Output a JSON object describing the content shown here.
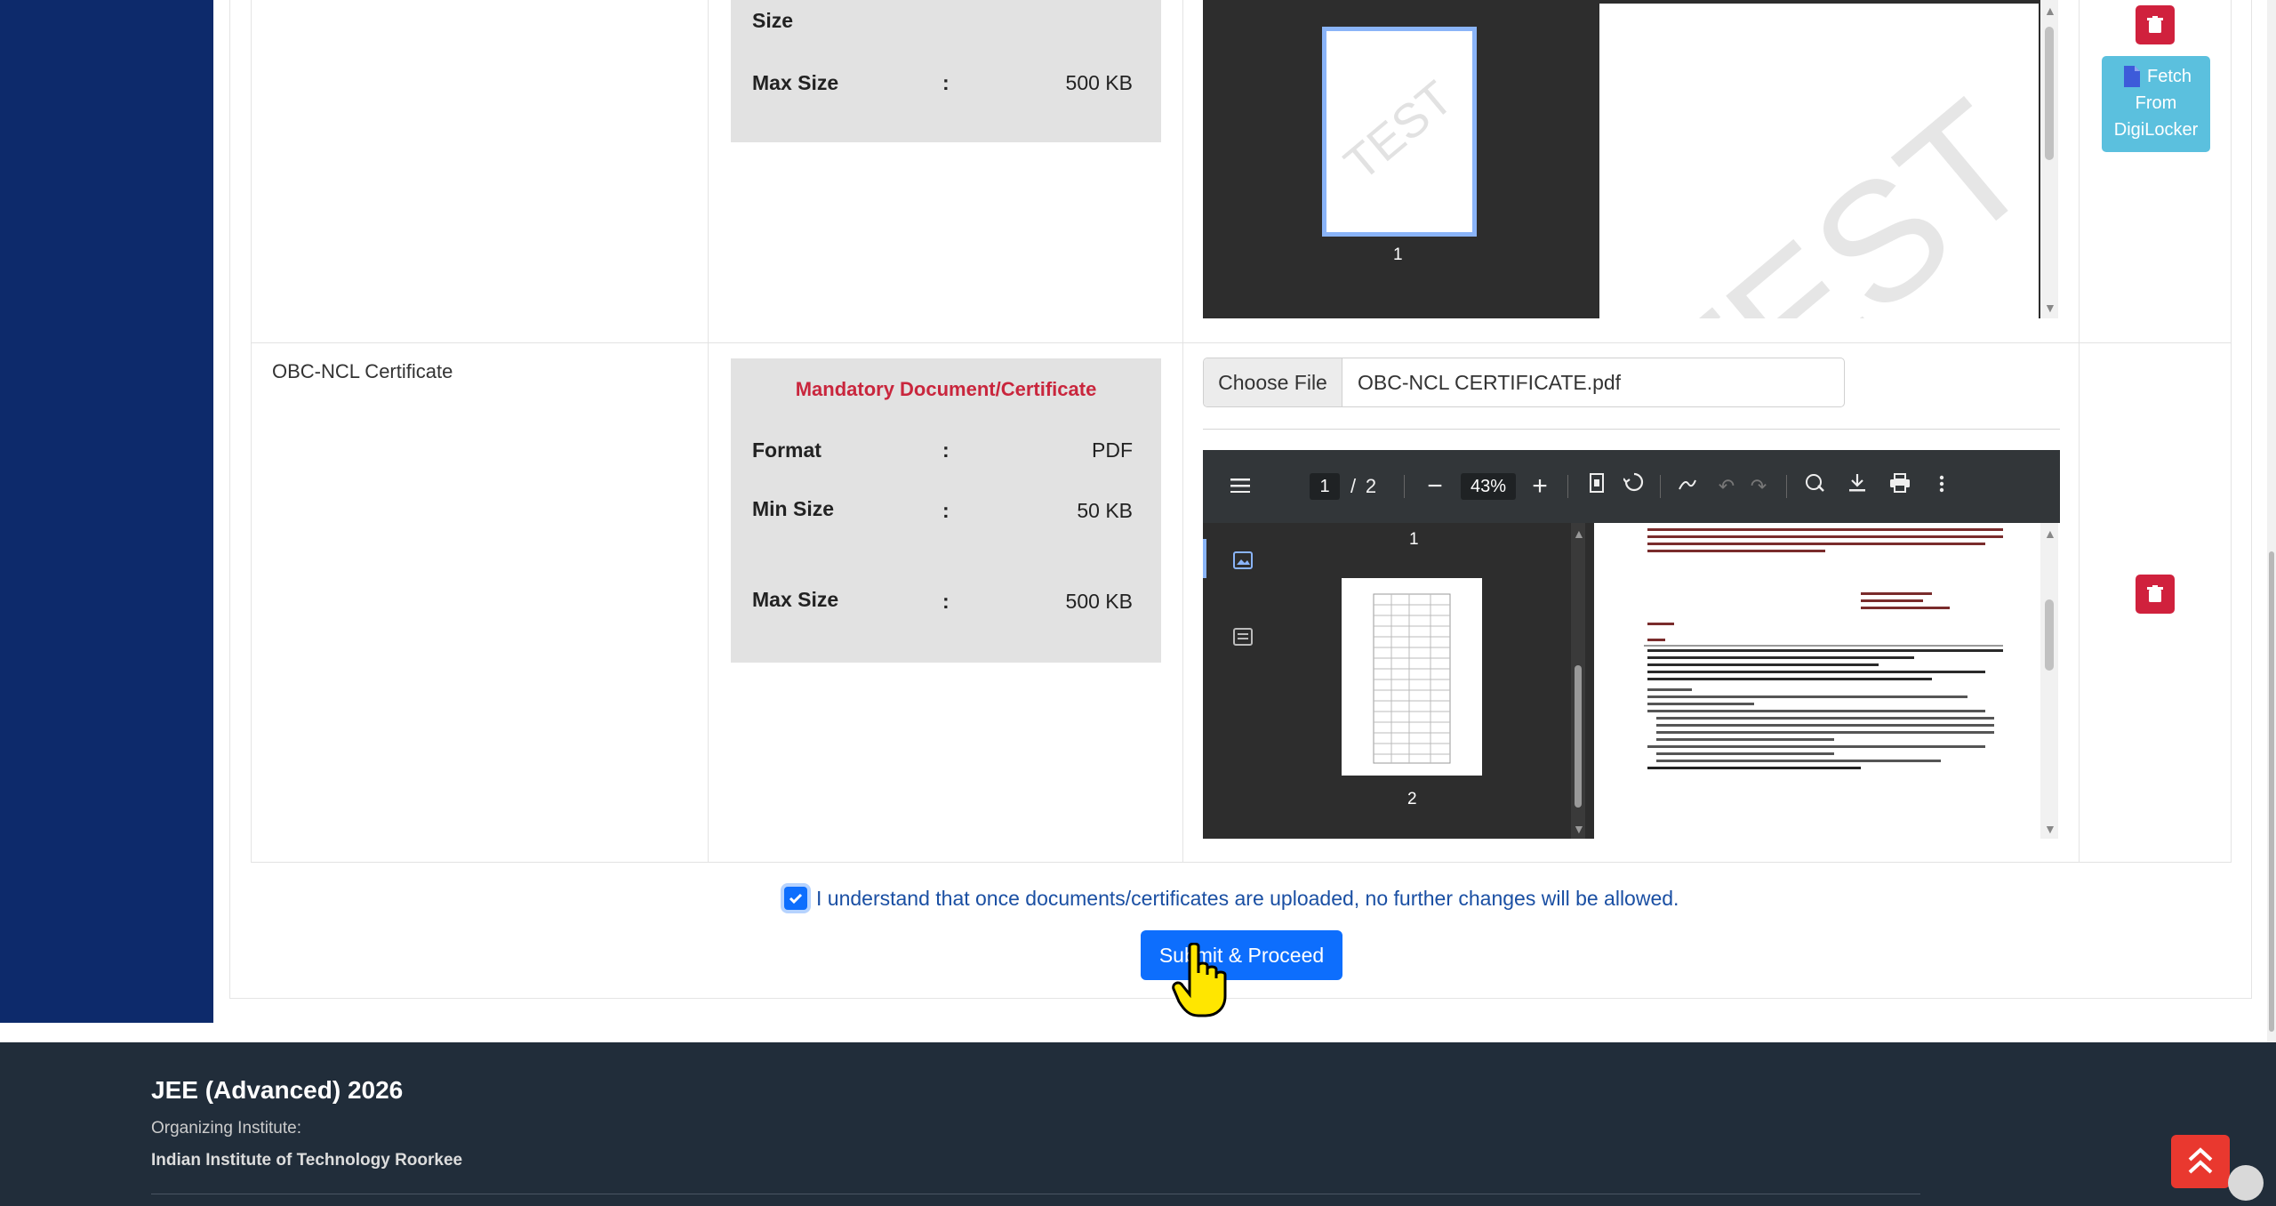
{
  "documents": [
    {
      "name": "",
      "requirements": {
        "title": "",
        "max_label": "Max Size",
        "max_value": "500 KB",
        "partial_label": "Size"
      },
      "preview": {
        "thumb_page": "1",
        "watermark": "TEST"
      },
      "digilocker_button": "Fetch From DigiLocker"
    },
    {
      "name": "OBC-NCL Certificate",
      "requirements": {
        "title": "Mandatory Document/Certificate",
        "format_label": "Format",
        "format_value": "PDF",
        "min_label": "Min Size",
        "min_value": "50 KB",
        "max_label": "Max Size",
        "max_value": "500 KB",
        "colon": ":"
      },
      "file_input": {
        "button_label": "Choose File",
        "file_name": "OBC-NCL CERTIFICATE.pdf"
      },
      "viewer": {
        "current_page": "1",
        "page_separator": "/",
        "total_pages": "2",
        "zoom": "43%",
        "thumb_page_1": "1",
        "thumb_page_2": "2"
      }
    }
  ],
  "agreement": {
    "checked": true,
    "text": "I understand that once documents/certificates are uploaded, no further changes will be allowed."
  },
  "submit_label": "Submit & Proceed",
  "footer": {
    "title": "JEE (Advanced) 2026",
    "organizing_label": "Organizing Institute:",
    "institute": "Indian Institute of Technology Roorkee"
  },
  "icons": {
    "menu": "menu-icon",
    "zoom_out": "zoom-out-icon",
    "zoom_in": "zoom-in-icon",
    "fit_page": "fit-page-icon",
    "rotate": "rotate-icon",
    "draw": "draw-icon",
    "undo": "undo-icon",
    "redo": "redo-icon",
    "save_annot": "annotation-icon",
    "download": "download-icon",
    "print": "print-icon",
    "more": "more-options-icon",
    "delete": "trash-icon",
    "back_to_top": "chevron-double-up-icon"
  },
  "colors": {
    "sidebar": "#0d2a6b",
    "primary": "#0d6efd",
    "danger": "#d0213d",
    "info": "#5bc0de",
    "footer": "#212d3a",
    "mandatory_text": "#c9263d"
  }
}
